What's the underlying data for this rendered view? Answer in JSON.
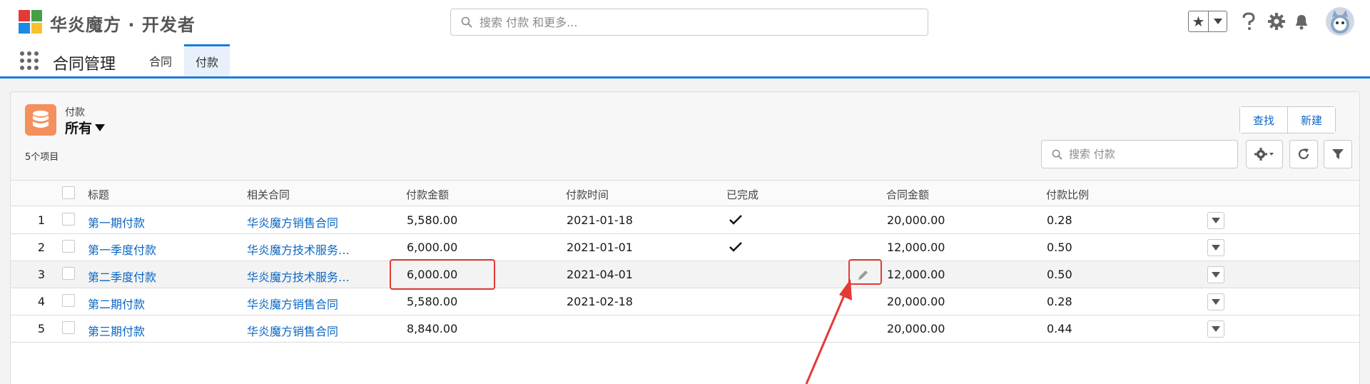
{
  "header": {
    "brand": "华炎魔方 · 开发者",
    "search_placeholder": "搜索 付款 和更多...",
    "logo_colors": [
      "#e53935",
      "#43a047",
      "#1e88e5",
      "#fbc02d"
    ]
  },
  "nav": {
    "app_name": "合同管理",
    "tabs": [
      {
        "label": "合同",
        "active": false
      },
      {
        "label": "付款",
        "active": true
      }
    ]
  },
  "list": {
    "object_label": "付款",
    "view_name": "所有",
    "item_count": "5个项目",
    "find_label": "查找",
    "new_label": "新建",
    "search_placeholder": "搜索 付款",
    "columns": [
      "标题",
      "相关合同",
      "付款金额",
      "付款时间",
      "已完成",
      "合同金额",
      "付款比例"
    ],
    "rows": [
      {
        "index": "1",
        "title": "第一期付款",
        "contract": "华炎魔方销售合同",
        "amount": "5,580.00",
        "date": "2021-01-18",
        "done": true,
        "contract_amount": "20,000.00",
        "ratio": "0.28"
      },
      {
        "index": "2",
        "title": "第一季度付款",
        "contract": "华炎魔方技术服务…",
        "amount": "6,000.00",
        "date": "2021-01-01",
        "done": true,
        "contract_amount": "12,000.00",
        "ratio": "0.50"
      },
      {
        "index": "3",
        "title": "第二季度付款",
        "contract": "华炎魔方技术服务…",
        "amount": "6,000.00",
        "date": "2021-04-01",
        "done": false,
        "contract_amount": "12,000.00",
        "ratio": "0.50"
      },
      {
        "index": "4",
        "title": "第二期付款",
        "contract": "华炎魔方销售合同",
        "amount": "5,580.00",
        "date": "2021-02-18",
        "done": false,
        "contract_amount": "20,000.00",
        "ratio": "0.28"
      },
      {
        "index": "5",
        "title": "第三期付款",
        "contract": "华炎魔方销售合同",
        "amount": "8,840.00",
        "date": "",
        "done": false,
        "contract_amount": "20,000.00",
        "ratio": "0.44"
      }
    ]
  },
  "colors": {
    "accent": "#1b7ddf",
    "link": "#0b66c3",
    "object_icon": "#f58f5d",
    "annotation": "#e53935"
  }
}
